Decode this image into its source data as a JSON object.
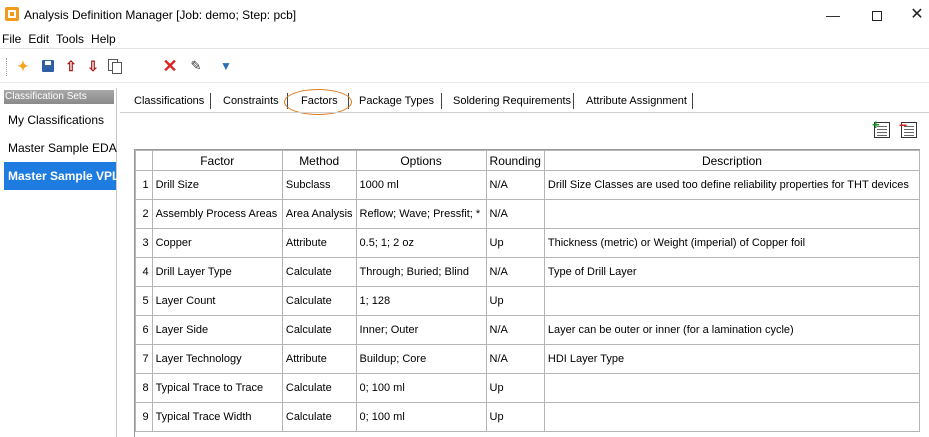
{
  "window": {
    "title": "Analysis Definition Manager [Job: demo; Step: pcb]",
    "minimize": "—",
    "close": "✕"
  },
  "menu": [
    "File",
    "Edit",
    "Tools",
    "Help"
  ],
  "toolbar": {
    "icons": [
      "new-icon",
      "save-icon",
      "export-icon",
      "import-icon",
      "copy-icon",
      "delete-icon",
      "edit-icon",
      "filter-icon"
    ]
  },
  "sidebar": {
    "header": "Classification Sets",
    "items": [
      {
        "label": "My Classifications",
        "selected": false
      },
      {
        "label": "Master Sample EDA",
        "selected": false
      },
      {
        "label": "Master Sample VPL",
        "selected": true
      }
    ]
  },
  "tabs": [
    {
      "label": "Classifications"
    },
    {
      "label": "Constraints"
    },
    {
      "label": "Factors",
      "active": true
    },
    {
      "label": "Package Types"
    },
    {
      "label": "Soldering Requirements"
    },
    {
      "label": "Attribute Assignment"
    }
  ],
  "table": {
    "columns": [
      "Factor",
      "Method",
      "Options",
      "Rounding",
      "Description"
    ],
    "rows": [
      {
        "n": "1",
        "factor": "Drill Size",
        "method": "Subclass",
        "options": "1000 ml",
        "rounding": "N/A",
        "description": "Drill Size Classes are used too define reliability properties for THT devices"
      },
      {
        "n": "2",
        "factor": "Assembly Process Areas",
        "method": "Area Analysis",
        "options": "Reflow; Wave; Pressfit; *",
        "rounding": "N/A",
        "description": ""
      },
      {
        "n": "3",
        "factor": "Copper",
        "method": "Attribute",
        "options": "0.5; 1; 2 oz",
        "rounding": "Up",
        "description": "Thickness (metric) or Weight (imperial) of Copper foil"
      },
      {
        "n": "4",
        "factor": "Drill Layer Type",
        "method": "Calculate",
        "options": "Through; Buried; Blind",
        "rounding": "N/A",
        "description": "Type of Drill Layer"
      },
      {
        "n": "5",
        "factor": "Layer Count",
        "method": "Calculate",
        "options": "1; 128",
        "rounding": "Up",
        "description": ""
      },
      {
        "n": "6",
        "factor": "Layer Side",
        "method": "Calculate",
        "options": "Inner; Outer",
        "rounding": "N/A",
        "description": "Layer can be outer or inner (for a lamination cycle)"
      },
      {
        "n": "7",
        "factor": "Layer Technology",
        "method": "Attribute",
        "options": "Buildup; Core",
        "rounding": "N/A",
        "description": "HDI Layer Type"
      },
      {
        "n": "8",
        "factor": "Typical Trace to Trace",
        "method": "Calculate",
        "options": "0; 100 ml",
        "rounding": "Up",
        "description": ""
      },
      {
        "n": "9",
        "factor": "Typical Trace Width",
        "method": "Calculate",
        "options": "0; 100 ml",
        "rounding": "Up",
        "description": ""
      }
    ]
  },
  "colors": {
    "selection": "#1e7be0",
    "highlight_circle": "#e07b24",
    "app_icon": "#f29a1d"
  }
}
